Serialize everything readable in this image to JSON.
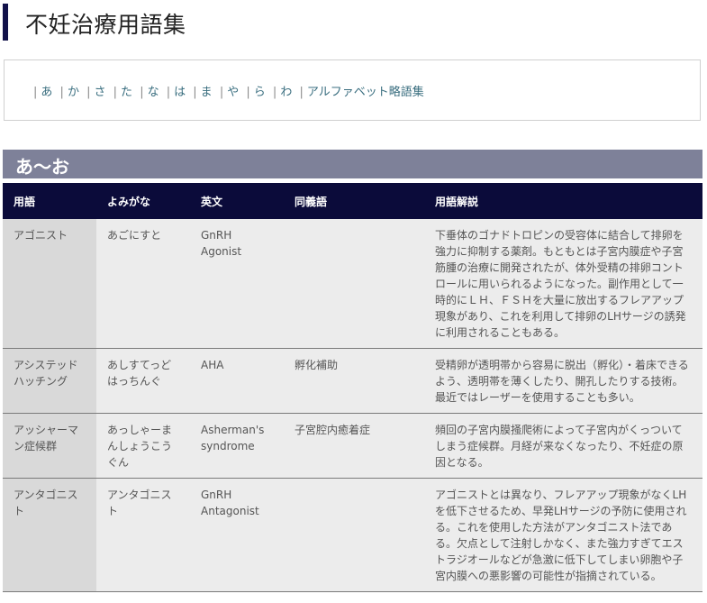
{
  "page": {
    "title": "不妊治療用語集"
  },
  "index_nav": {
    "separator": "|",
    "items": [
      "あ",
      "か",
      "さ",
      "た",
      "な",
      "は",
      "ま",
      "や",
      "ら",
      "わ",
      "アルファベット略語集"
    ]
  },
  "section": {
    "heading": "あ〜お"
  },
  "table": {
    "headers": [
      "用語",
      "よみがな",
      "英文",
      "同義語",
      "用語解説"
    ],
    "rows": [
      {
        "term": "アゴニスト",
        "reading": "あごにすと",
        "english": "GnRH Agonist",
        "synonym": "",
        "definition": "下垂体のゴナドトロピンの受容体に結合して排卵を強力に抑制する薬剤。もともとは子宮内膜症や子宮筋腫の治療に開発されたが、体外受精の排卵コントロールに用いられるようになった。副作用として一時的にＬＨ、ＦＳＨを大量に放出するフレアアップ現象があり、これを利用して排卵のLHサージの誘発に利用されることもある。"
      },
      {
        "term": "アシステッドハッチング",
        "reading": "あしすてっどはっちんぐ",
        "english": "AHA",
        "synonym": "孵化補助",
        "definition": "受精卵が透明帯から容易に脱出（孵化）・着床できるよう、透明帯を薄くしたり、開孔したりする技術。最近ではレーザーを使用することも多い。"
      },
      {
        "term": "アッシャーマン症候群",
        "reading": "あっしゃーまんしょうこうぐん",
        "english": "Asherman's syndrome",
        "synonym": "子宮腔内癒着症",
        "definition": "頻回の子宮内膜掻爬術によって子宮内がくっついてしまう症候群。月経が来なくなったり、不妊症の原因となる。"
      },
      {
        "term": "アンタゴニスト",
        "reading": "アンタゴニスト",
        "english": "GnRH Antagonist",
        "synonym": "",
        "definition": "アゴニストとは異なり、フレアアップ現象がなくLHを低下させるため、早発LHサージの予防に使用される。これを使用した方法がアンタゴニスト法である。欠点として注射しかなく、また強力すぎてエストラジオールなどが急激に低下してしまい卵胞や子宮内膜への悪影響の可能性が指摘されている。"
      }
    ]
  }
}
